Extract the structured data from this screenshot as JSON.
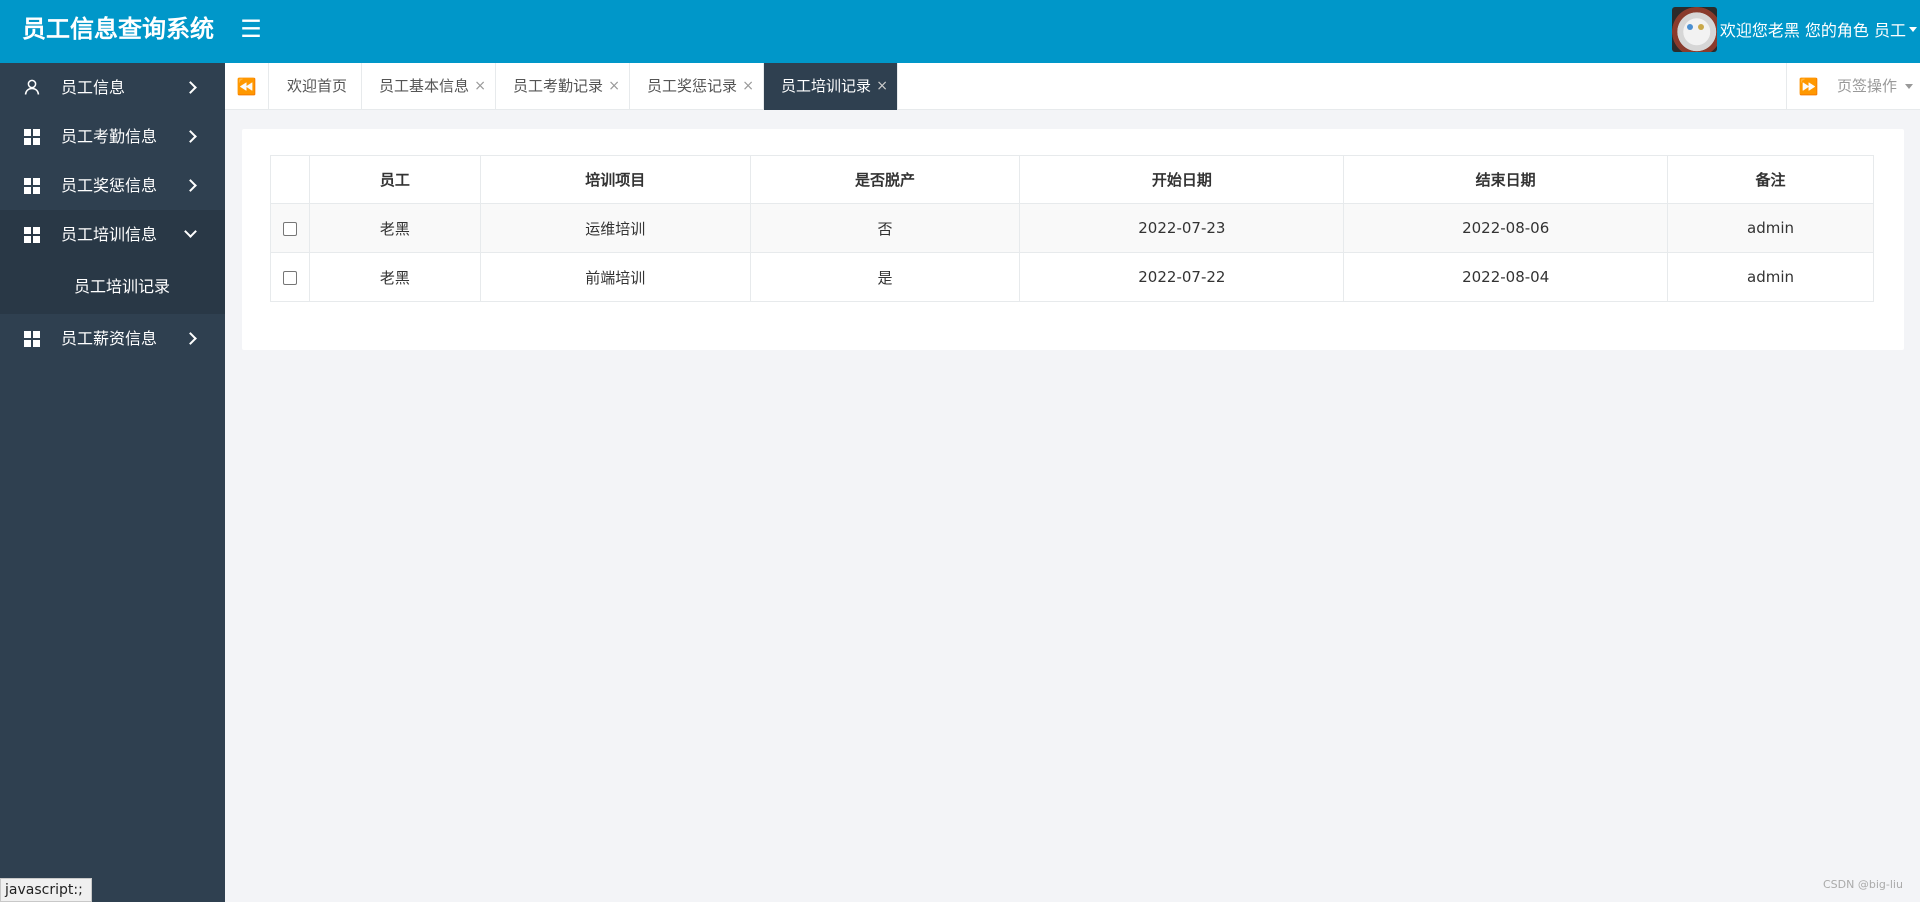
{
  "header": {
    "brand": "员工信息查询系统",
    "menu_toggle": "☰",
    "welcome": "欢迎您老黑 您的角色 员工"
  },
  "sidebar": {
    "items": [
      {
        "label": "员工信息",
        "icon": "user-icon",
        "open": false
      },
      {
        "label": "员工考勤信息",
        "icon": "grid-icon",
        "open": false
      },
      {
        "label": "员工奖惩信息",
        "icon": "grid-icon",
        "open": false
      },
      {
        "label": "员工培训信息",
        "icon": "grid-icon",
        "open": true,
        "children": [
          {
            "label": "员工培训记录"
          }
        ]
      },
      {
        "label": "员工薪资信息",
        "icon": "grid-icon",
        "open": false
      }
    ]
  },
  "tabs": {
    "scroll_left": "⏪",
    "scroll_right": "⏩",
    "items": [
      {
        "label": "欢迎首页",
        "closable": false,
        "active": false
      },
      {
        "label": "员工基本信息",
        "closable": true,
        "active": false
      },
      {
        "label": "员工考勤记录",
        "closable": true,
        "active": false
      },
      {
        "label": "员工奖惩记录",
        "closable": true,
        "active": false
      },
      {
        "label": "员工培训记录",
        "closable": true,
        "active": true
      }
    ],
    "close_glyph": "×",
    "page_ops": "页签操作"
  },
  "table": {
    "columns": [
      "员工",
      "培训项目",
      "是否脱产",
      "开始日期",
      "结束日期",
      "备注"
    ],
    "rows": [
      [
        "老黑",
        "运维培训",
        "否",
        "2022-07-23",
        "2022-08-06",
        "admin"
      ],
      [
        "老黑",
        "前端培训",
        "是",
        "2022-07-22",
        "2022-08-04",
        "admin"
      ]
    ]
  },
  "status_bar": "javascript:;",
  "watermark": "CSDN @big-liu",
  "colors": {
    "header_bg": "#0097c9",
    "sidebar_bg": "#2f4050",
    "active_tab_bg": "#2f4050",
    "content_bg": "#f3f4f7"
  }
}
